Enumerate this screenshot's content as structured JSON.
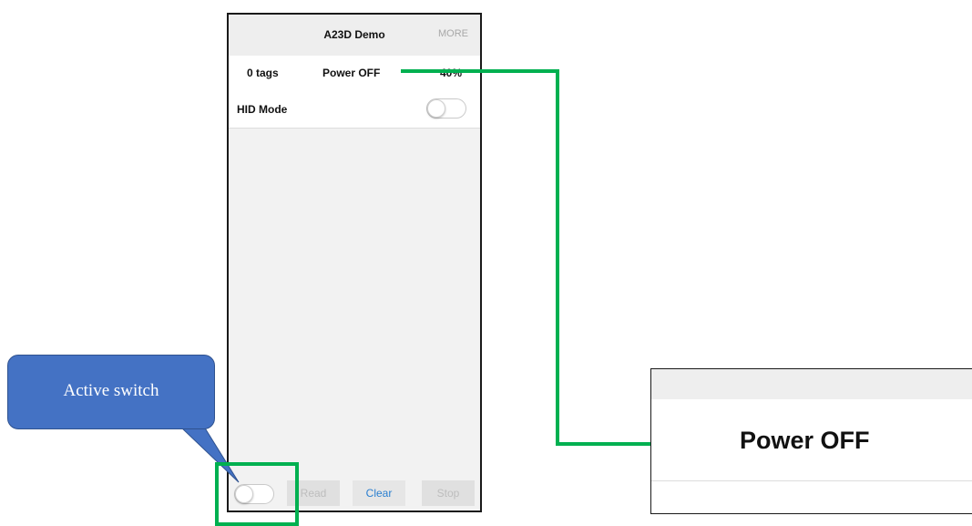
{
  "phone": {
    "header": {
      "title": "A23D Demo",
      "more_label": "MORE"
    },
    "status": {
      "tag_count": "0 tags",
      "power": "Power OFF",
      "percent": "40%"
    },
    "hid_mode": {
      "label": "HID Mode",
      "enabled": false
    },
    "bottom_bar": {
      "active_switch_on": false,
      "read_label": "Read",
      "clear_label": "Clear",
      "stop_label": "Stop"
    }
  },
  "annotations": {
    "callout_text": "Active switch",
    "zoom_text": "Power OFF",
    "highlight_color": "#00b050",
    "callout_color": "#4472c4"
  },
  "colors": {
    "accent_blue": "#2a7fd0",
    "disabled_text": "#bdbdbd"
  }
}
